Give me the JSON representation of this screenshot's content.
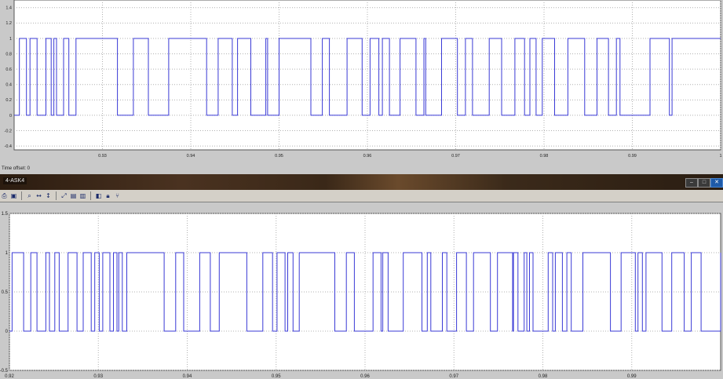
{
  "top": {
    "status": "Time offset:  0"
  },
  "window": {
    "title": "4-ASK4",
    "controls": [
      "minimize",
      "maximize",
      "close"
    ]
  },
  "toolbar": {
    "icons": [
      "print-icon",
      "parameters-icon",
      "zoom-icon",
      "zoom-x-icon",
      "zoom-y-icon",
      "autoscale-icon",
      "save-axes-icon",
      "restore-axes-icon",
      "floating-scope-icon",
      "lock-icon",
      "signal-selection-icon"
    ]
  },
  "chart_data": [
    {
      "type": "line",
      "step": true,
      "xlim": [
        0.92,
        1.0
      ],
      "ylim": [
        -0.45,
        1.5
      ],
      "xticks": [
        0.93,
        0.94,
        0.95,
        0.96,
        0.97,
        0.98,
        0.99,
        1.0
      ],
      "xtick_labels": [
        "0.93",
        "0.94",
        "0.95",
        "0.96",
        "0.97",
        "0.98",
        "0.99",
        "1"
      ],
      "yticks": [
        -0.4,
        -0.2,
        0,
        0.2,
        0.4,
        0.6,
        0.8,
        1,
        1.2,
        1.4
      ],
      "ytick_labels": [
        "-0.4",
        "-0.2",
        "0",
        "0.2",
        "0.4",
        "0.6",
        "0.8",
        "1",
        "1.2",
        "1.4"
      ],
      "grid": true,
      "color": "#3a3ad6",
      "x": [
        0.92,
        0.9206,
        0.9214,
        0.9218,
        0.9226,
        0.9236,
        0.9242,
        0.9245,
        0.9248,
        0.9256,
        0.9262,
        0.927,
        0.9317,
        0.9335,
        0.9352,
        0.9375,
        0.9418,
        0.9431,
        0.9447,
        0.9453,
        0.9468,
        0.9485,
        0.9487,
        0.95,
        0.9536,
        0.9549,
        0.9557,
        0.9577,
        0.9594,
        0.9603,
        0.9613,
        0.9617,
        0.9625,
        0.9637,
        0.9655,
        0.9664,
        0.9666,
        0.9684,
        0.9702,
        0.9711,
        0.9719,
        0.9738,
        0.9752,
        0.9767,
        0.9778,
        0.9784,
        0.9791,
        0.9798,
        0.9812,
        0.9827,
        0.9846,
        0.986,
        0.9873,
        0.9882,
        0.9886,
        0.992,
        0.9942,
        0.9945,
        1.0
      ],
      "y": [
        0,
        1,
        0,
        1,
        0,
        1,
        0,
        1,
        0,
        1,
        0,
        1,
        0,
        1,
        0,
        1,
        0,
        1,
        0,
        1,
        0,
        1,
        0,
        1,
        0,
        1,
        0,
        1,
        0,
        1,
        0,
        1,
        0,
        1,
        0,
        1,
        0,
        1,
        0,
        1,
        0,
        1,
        0,
        1,
        0,
        1,
        0,
        1,
        0,
        1,
        0,
        1,
        0,
        1,
        0,
        1,
        0,
        1,
        1
      ]
    },
    {
      "type": "line",
      "step": true,
      "xlim": [
        0.92,
        1.0
      ],
      "ylim": [
        -0.5,
        1.5
      ],
      "xticks": [
        0.92,
        0.93,
        0.94,
        0.95,
        0.96,
        0.97,
        0.98,
        0.99
      ],
      "xtick_labels": [
        "0.92",
        "0.93",
        "0.94",
        "0.95",
        "0.96",
        "0.97",
        "0.98",
        "0.99"
      ],
      "yticks": [
        -0.5,
        0,
        0.5,
        1,
        1.5
      ],
      "ytick_labels": [
        "-0.5",
        "0",
        "0.5",
        "1",
        "1.5"
      ],
      "grid": true,
      "color": "#3a3ad6",
      "x": [
        0.92,
        0.9203,
        0.9216,
        0.9224,
        0.9231,
        0.9241,
        0.9245,
        0.9251,
        0.9256,
        0.9266,
        0.9276,
        0.9283,
        0.9292,
        0.9296,
        0.9301,
        0.9305,
        0.9313,
        0.9317,
        0.9321,
        0.9323,
        0.9327,
        0.9332,
        0.9374,
        0.9387,
        0.9396,
        0.9414,
        0.9426,
        0.9436,
        0.9467,
        0.9485,
        0.9496,
        0.9501,
        0.951,
        0.9513,
        0.9519,
        0.9526,
        0.9566,
        0.9579,
        0.9588,
        0.9609,
        0.9618,
        0.962,
        0.9626,
        0.9643,
        0.9664,
        0.967,
        0.9674,
        0.9687,
        0.9692,
        0.9703,
        0.9714,
        0.9722,
        0.9741,
        0.9749,
        0.9766,
        0.9767,
        0.9772,
        0.9779,
        0.9782,
        0.9785,
        0.9789,
        0.9806,
        0.9811,
        0.9814,
        0.9822,
        0.9827,
        0.9832,
        0.9845,
        0.9876,
        0.9888,
        0.9904,
        0.9907,
        0.9912,
        0.9916,
        0.9934,
        0.9945,
        0.9959,
        0.9967,
        0.9978,
        1.0
      ],
      "y": [
        0,
        1,
        0,
        1,
        0,
        1,
        0,
        1,
        0,
        1,
        0,
        1,
        0,
        1,
        0,
        1,
        0,
        1,
        0,
        1,
        0,
        1,
        0,
        1,
        0,
        1,
        0,
        1,
        0,
        1,
        0,
        1,
        0,
        1,
        0,
        1,
        0,
        1,
        0,
        1,
        0,
        1,
        0,
        1,
        0,
        1,
        0,
        1,
        0,
        1,
        0,
        1,
        0,
        1,
        0,
        1,
        0,
        1,
        0,
        1,
        0,
        1,
        0,
        1,
        0,
        1,
        0,
        1,
        0,
        1,
        0,
        1,
        0,
        1,
        0,
        1,
        0,
        1,
        0,
        1
      ]
    }
  ]
}
